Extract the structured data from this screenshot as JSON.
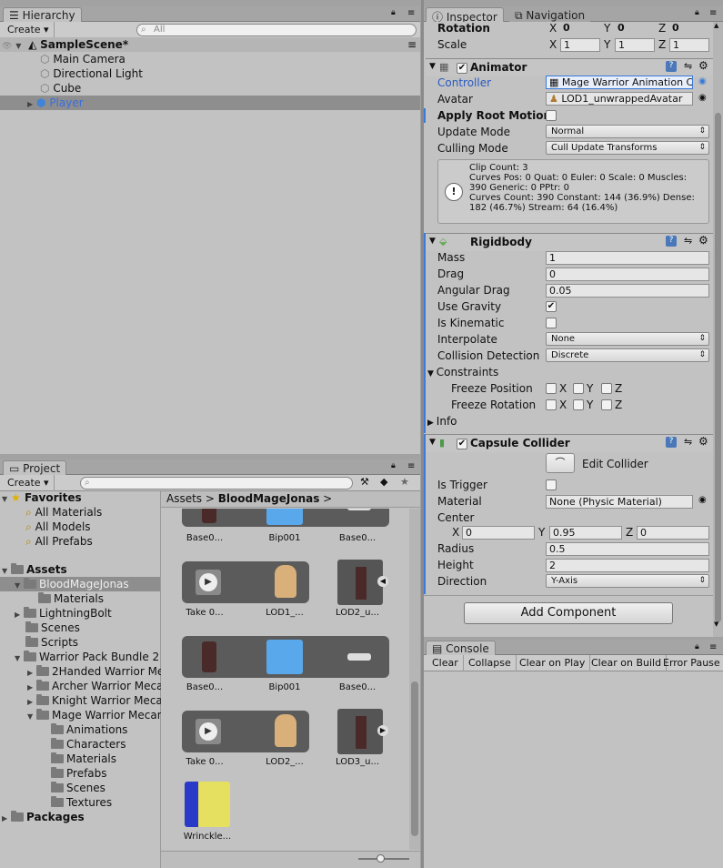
{
  "hierarchy": {
    "tab": "Hierarchy",
    "create": "Create",
    "search_placeholder": "All",
    "scene": "SampleScene*",
    "items": [
      "Main Camera",
      "Directional Light",
      "Cube",
      "Player"
    ]
  },
  "project": {
    "tab": "Project",
    "create": "Create",
    "favorites_label": "Favorites",
    "favorites": [
      "All Materials",
      "All Models",
      "All Prefabs"
    ],
    "assets_label": "Assets",
    "tree": [
      "BloodMageJonas",
      "Materials",
      "LightningBolt",
      "Scenes",
      "Scripts",
      "Warrior Pack Bundle 2",
      "2Handed Warrior Me",
      "Archer Warrior Meca",
      "Knight Warrior Meca",
      "Mage Warrior Mecan",
      "Animations",
      "Characters",
      "Materials",
      "Prefabs",
      "Scenes",
      "Textures"
    ],
    "packages_label": "Packages",
    "breadcrumb": [
      "Assets",
      "BloodMageJonas"
    ],
    "grid": [
      [
        "Base0...",
        "Bip001",
        "Base0..."
      ],
      [
        "Take 0...",
        "LOD1_...",
        "LOD2_u..."
      ],
      [
        "Base0...",
        "Bip001",
        "Base0..."
      ],
      [
        "Take 0...",
        "LOD2_...",
        "LOD3_u..."
      ],
      [
        "Wrinckle..."
      ]
    ]
  },
  "inspector": {
    "tab": "Inspector",
    "tab2": "Navigation",
    "rotation_label": "Rotation",
    "rotation": {
      "x": "0",
      "y": "0",
      "z": "0"
    },
    "scale_label": "Scale",
    "scale": {
      "x": "1",
      "y": "1",
      "z": "1"
    },
    "animator": {
      "title": "Animator",
      "controller_label": "Controller",
      "controller_value": "Mage Warrior Animation C",
      "avatar_label": "Avatar",
      "avatar_value": "LOD1_unwrappedAvatar",
      "apply_root_motion": "Apply Root Motion",
      "update_mode_label": "Update Mode",
      "update_mode": "Normal",
      "culling_mode_label": "Culling Mode",
      "culling_mode": "Cull Update Transforms",
      "info_lines": [
        "Clip Count: 3",
        "Curves Pos: 0 Quat: 0 Euler: 0 Scale: 0 Muscles:",
        "390 Generic: 0 PPtr: 0",
        "Curves Count: 390 Constant: 144 (36.9%) Dense:",
        "182 (46.7%) Stream: 64 (16.4%)"
      ]
    },
    "rigidbody": {
      "title": "Rigidbody",
      "mass_label": "Mass",
      "mass": "1",
      "drag_label": "Drag",
      "drag": "0",
      "angular_drag_label": "Angular Drag",
      "angular_drag": "0.05",
      "use_gravity": "Use Gravity",
      "is_kinematic": "Is Kinematic",
      "interpolate_label": "Interpolate",
      "interpolate": "None",
      "collision_label": "Collision Detection",
      "collision": "Discrete",
      "constraints": "Constraints",
      "freeze_position": "Freeze Position",
      "freeze_rotation": "Freeze Rotation",
      "info": "Info"
    },
    "capsule": {
      "title": "Capsule Collider",
      "edit_collider": "Edit Collider",
      "is_trigger": "Is Trigger",
      "material_label": "Material",
      "material": "None (Physic Material)",
      "center_label": "Center",
      "center": {
        "x": "0",
        "y": "0.95",
        "z": "0"
      },
      "radius_label": "Radius",
      "radius": "0.5",
      "height_label": "Height",
      "height": "2",
      "direction_label": "Direction",
      "direction": "Y-Axis"
    },
    "add_component": "Add Component"
  },
  "console": {
    "tab": "Console",
    "buttons": [
      "Clear",
      "Collapse",
      "Clear on Play",
      "Clear on Build",
      "Error Pause"
    ]
  },
  "axis": {
    "x": "X",
    "y": "Y",
    "z": "Z"
  }
}
